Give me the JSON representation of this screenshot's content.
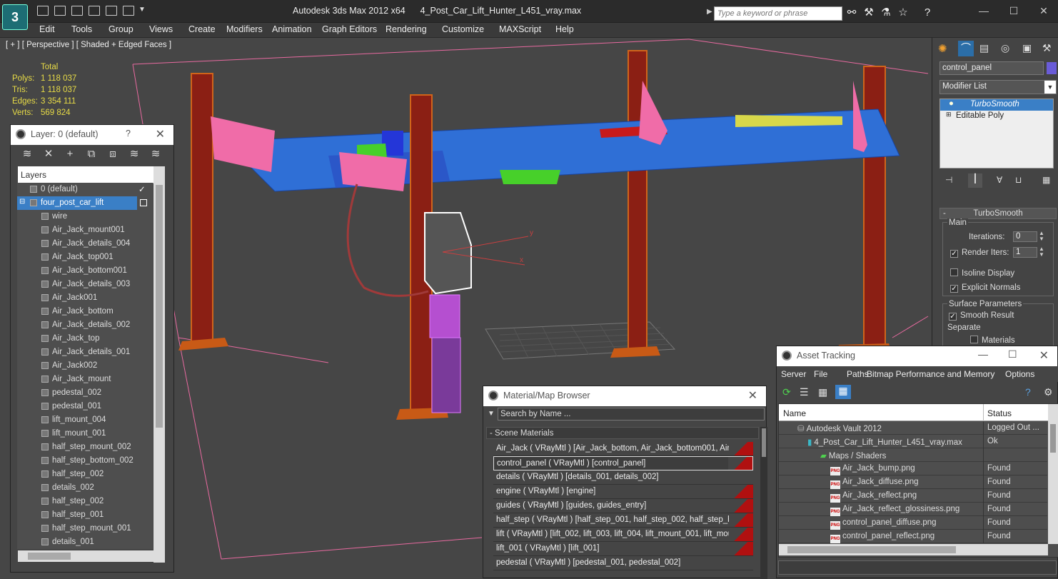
{
  "app": {
    "title": "Autodesk 3ds Max  2012 x64",
    "filename": "4_Post_Car_Lift_Hunter_L451_vray.max",
    "logo_text": "3",
    "search_placeholder": "Type a keyword or phrase"
  },
  "menu": [
    "Edit",
    "Tools",
    "Group",
    "Views",
    "Create",
    "Modifiers",
    "Animation",
    "Graph Editors",
    "Rendering",
    "Customize",
    "MAXScript",
    "Help"
  ],
  "viewport": {
    "label": "[ + ] [ Perspective ] [ Shaded + Edged Faces ]",
    "stats": {
      "header": "Total",
      "rows": [
        {
          "k": "Polys:",
          "v": "1 118 037"
        },
        {
          "k": "Tris:",
          "v": "1 118 037"
        },
        {
          "k": "Edges:",
          "v": "3 354 111"
        },
        {
          "k": "Verts:",
          "v": "569 824"
        }
      ]
    },
    "axis_x": "x",
    "axis_y": "y"
  },
  "layer_panel": {
    "title": "Layer: 0 (default)",
    "help": "?",
    "close": "✕",
    "column": "Layers",
    "rows": [
      {
        "label": "0 (default)",
        "indent": 1,
        "check": "✓"
      },
      {
        "label": "four_post_car_lift",
        "indent": 1,
        "selected": true
      },
      {
        "label": "wire",
        "indent": 2
      },
      {
        "label": "Air_Jack_mount001",
        "indent": 2
      },
      {
        "label": "Air_Jack_details_004",
        "indent": 2
      },
      {
        "label": "Air_Jack_top001",
        "indent": 2
      },
      {
        "label": "Air_Jack_bottom001",
        "indent": 2
      },
      {
        "label": "Air_Jack_details_003",
        "indent": 2
      },
      {
        "label": "Air_Jack001",
        "indent": 2
      },
      {
        "label": "Air_Jack_bottom",
        "indent": 2
      },
      {
        "label": "Air_Jack_details_002",
        "indent": 2
      },
      {
        "label": "Air_Jack_top",
        "indent": 2
      },
      {
        "label": "Air_Jack_details_001",
        "indent": 2
      },
      {
        "label": "Air_Jack002",
        "indent": 2
      },
      {
        "label": "Air_Jack_mount",
        "indent": 2
      },
      {
        "label": "pedestal_002",
        "indent": 2
      },
      {
        "label": "pedestal_001",
        "indent": 2
      },
      {
        "label": "lift_mount_004",
        "indent": 2
      },
      {
        "label": "lift_mount_001",
        "indent": 2
      },
      {
        "label": "half_step_mount_002",
        "indent": 2
      },
      {
        "label": "half_step_bottom_002",
        "indent": 2
      },
      {
        "label": "half_step_002",
        "indent": 2
      },
      {
        "label": "details_002",
        "indent": 2
      },
      {
        "label": "half_step_002",
        "indent": 2
      },
      {
        "label": "half_step_001",
        "indent": 2
      },
      {
        "label": "half_step_mount_001",
        "indent": 2
      },
      {
        "label": "details_001",
        "indent": 2
      }
    ]
  },
  "command_panel": {
    "object_name": "control_panel",
    "modifier_list": "Modifier List",
    "stack": [
      "TurboSmooth",
      "Editable Poly"
    ],
    "rollout_title": "TurboSmooth",
    "main_label": "Main",
    "iterations_label": "Iterations:",
    "iterations_value": "0",
    "render_iters_label": "Render Iters:",
    "render_iters_value": "1",
    "isoline": "Isoline Display",
    "explicit": "Explicit Normals",
    "surface_label": "Surface Parameters",
    "smooth_result": "Smooth Result",
    "separate": "Separate",
    "materials": "Materials"
  },
  "material_browser": {
    "title": "Material/Map Browser",
    "search_placeholder": "Search by Name ...",
    "group": "- Scene Materials",
    "rows": [
      "Air_Jack  ( VRayMtl ) [Air_Jack_bottom, Air_Jack_bottom001, Air_Ja...",
      "control_panel  ( VRayMtl ) [control_panel]",
      "details  ( VRayMtl ) [details_001, details_002]",
      "engine  ( VRayMtl ) [engine]",
      "guides  ( VRayMtl ) [guides, guides_entry]",
      "half_step  ( VRayMtl ) [half_step_001, half_step_002, half_step_bott...",
      "lift  ( VRayMtl ) [lift_002, lift_003, lift_004, lift_mount_001, lift_mou...",
      "lift_001  ( VRayMtl ) [lift_001]",
      "pedestal  ( VRayMtl ) [pedestal_001, pedestal_002]"
    ]
  },
  "asset_tracking": {
    "title": "Asset Tracking",
    "menu": [
      "Server",
      "File",
      "Paths",
      "Bitmap Performance and Memory",
      "Options"
    ],
    "col_name": "Name",
    "col_status": "Status",
    "rows": [
      {
        "name": "Autodesk Vault 2012",
        "status": "Logged Out ...",
        "indent": 1,
        "kind": "vault"
      },
      {
        "name": "4_Post_Car_Lift_Hunter_L451_vray.max",
        "status": "Ok",
        "indent": 2,
        "kind": "max"
      },
      {
        "name": "Maps / Shaders",
        "status": "",
        "indent": 3,
        "kind": "folder"
      },
      {
        "name": "Air_Jack_bump.png",
        "status": "Found",
        "indent": 4,
        "kind": "png"
      },
      {
        "name": "Air_Jack_diffuse.png",
        "status": "Found",
        "indent": 4,
        "kind": "png"
      },
      {
        "name": "Air_Jack_reflect.png",
        "status": "Found",
        "indent": 4,
        "kind": "png"
      },
      {
        "name": "Air_Jack_reflect_glossiness.png",
        "status": "Found",
        "indent": 4,
        "kind": "png"
      },
      {
        "name": "control_panel_diffuse.png",
        "status": "Found",
        "indent": 4,
        "kind": "png"
      },
      {
        "name": "control_panel_reflect.png",
        "status": "Found",
        "indent": 4,
        "kind": "png"
      }
    ],
    "png_tag": "PNG"
  },
  "colors": {
    "accent": "#3a7fc6",
    "wire_orange": "#c85a16",
    "wire_pink": "#f06ca8",
    "wire_blue": "#2f6fd6",
    "wire_green": "#47d02a",
    "selection": "#ffffff"
  }
}
